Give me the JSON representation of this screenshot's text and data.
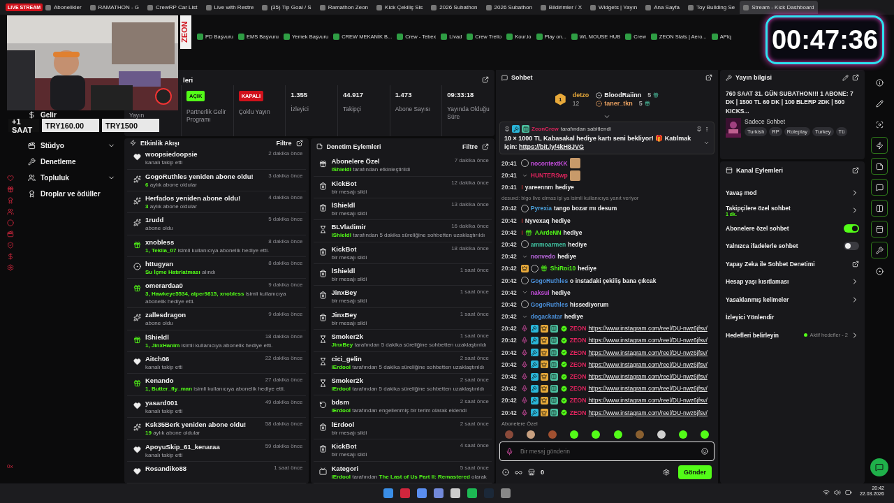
{
  "overlay": {
    "live": "LIVE STREAM",
    "brand": "ZEON",
    "donation": [
      "+1 SAAT",
      "TRY160.00",
      "TRY1500"
    ],
    "timer": "00:47:36"
  },
  "browser_tabs": [
    {
      "label": "Abonelikler",
      "selected": false
    },
    {
      "label": "RAMATHON - G",
      "selected": false
    },
    {
      "label": "CrewRP Car List",
      "selected": false
    },
    {
      "label": "Live with Restre",
      "selected": false
    },
    {
      "label": "(35) Tip Goal / S",
      "selected": false
    },
    {
      "label": "Ramathon Zeon",
      "selected": false
    },
    {
      "label": "Kick Çekiliş Sis",
      "selected": false
    },
    {
      "label": "2026 Subathon",
      "selected": false
    },
    {
      "label": "2026 Subathon",
      "selected": false
    },
    {
      "label": "Bildirimler / X",
      "selected": false
    },
    {
      "label": "Widgets | Yayın",
      "selected": false
    },
    {
      "label": "Ana Sayfa",
      "selected": false
    },
    {
      "label": "Toy Building Se",
      "selected": false
    },
    {
      "label": "Stream - Kick Dashboard",
      "selected": true
    }
  ],
  "bookmarks": [
    "PD Başvuru",
    "EMS Başvuru",
    "Yemek Başvuru",
    "CREW MEKANİK B...",
    "Crew - Tebex",
    "Livad",
    "Crew Trello",
    "Kour.io",
    "Play on...",
    "WL MOUSE HUB",
    "Crew",
    "ZEON Stats | Aero...",
    "APIq"
  ],
  "sidebar": {
    "items": [
      {
        "label": "Gelir",
        "kind": "plain"
      },
      {
        "label": "Stüdyo",
        "kind": "group"
      },
      {
        "label": "Denetleme",
        "kind": "plain"
      },
      {
        "label": "Topluluk",
        "kind": "group"
      },
      {
        "label": "Droplar ve ödüller",
        "kind": "plain"
      }
    ],
    "footer": "0x"
  },
  "stats": {
    "title": "leri",
    "cells": [
      {
        "kind": "label",
        "label": "Yayın"
      },
      {
        "kind": "badge",
        "badge": "AÇIK",
        "on": true,
        "label": "Partnerlik Gelir Programı"
      },
      {
        "kind": "badge",
        "badge": "KAPALI",
        "on": false,
        "label": "Çoklu Yayın"
      },
      {
        "kind": "value",
        "value": "1.355",
        "label": "İzleyici"
      },
      {
        "kind": "value",
        "value": "44.917",
        "label": "Takipçi"
      },
      {
        "kind": "value",
        "value": "1.473",
        "label": "Abone Sayısı"
      },
      {
        "kind": "value",
        "value": "09:33:18",
        "label": "Yayında Olduğu Süre"
      }
    ]
  },
  "activity": {
    "title": "Etkinlik Akışı",
    "filter": "Filtre",
    "items": [
      {
        "kind": "follow",
        "title": "woopsiedoopsie",
        "time": "2 dakika önce",
        "detail": "kanalı takip etti"
      },
      {
        "kind": "sub",
        "title": "GogoRuthles yeniden abone oldu!",
        "time": "3 dakika önce",
        "detail": "**6** aylık abone oldular"
      },
      {
        "kind": "sub",
        "title": "Herfados yeniden abone oldu!",
        "time": "4 dakika önce",
        "detail": "**3** aylık abone oldular"
      },
      {
        "kind": "sub",
        "title": "1rudd",
        "time": "5 dakika önce",
        "detail": "abone oldu"
      },
      {
        "kind": "gift",
        "title": "xnobless",
        "time": "8 dakika önce",
        "detail": "**1, Tekila_07** isimli kullanıcıya abonelik hediye etti."
      },
      {
        "kind": "reward",
        "title": "httugyan",
        "time": "8 dakika önce",
        "detail": "**Su İçme Hatırlatması** alındı"
      },
      {
        "kind": "gift",
        "title": "omerardaa0",
        "time": "9 dakika önce",
        "detail": "**3, Hawkeye5534, alper9815, xnobless** isimli kullanıcıya abonelik hediye etti."
      },
      {
        "kind": "sub",
        "title": "zallesdragon",
        "time": "9 dakika önce",
        "detail": "abone oldu"
      },
      {
        "kind": "gift",
        "title": "lShieldl",
        "time": "18 dakika önce",
        "detail": "**1, JinxHanim** isimli kullanıcıya abonelik hediye etti."
      },
      {
        "kind": "follow",
        "title": "Aitch06",
        "time": "22 dakika önce",
        "detail": "kanalı takip etti"
      },
      {
        "kind": "gift",
        "title": "Kenando",
        "time": "27 dakika önce",
        "detail": "**1, Butter_fly_man** isimli kullanıcıya abonelik hediye etti."
      },
      {
        "kind": "follow",
        "title": "yasard001",
        "time": "49 dakika önce",
        "detail": "kanalı takip etti"
      },
      {
        "kind": "sub",
        "title": "Ksk35Berk yeniden abone oldu!",
        "time": "58 dakika önce",
        "detail": "**19** aylık abone oldular"
      },
      {
        "kind": "follow",
        "title": "ApoyuSkip_61_kenaraa",
        "time": "59 dakika önce",
        "detail": "kanalı takip etti"
      },
      {
        "kind": "follow",
        "title": "Rosandiko88",
        "time": "1 saat önce"
      }
    ]
  },
  "moderation": {
    "title": "Denetim Eylemleri",
    "filter": "Filtre",
    "items": [
      {
        "kind": "mode",
        "title": "Abonelere Özel",
        "time": "7 dakika önce",
        "detail": "**lShieldl** tarafından etkinleştirildi"
      },
      {
        "kind": "delete",
        "title": "KickBot",
        "time": "12 dakika önce",
        "detail": "bir mesajı sildi"
      },
      {
        "kind": "delete",
        "title": "lShieldl",
        "time": "13 dakika önce",
        "detail": "bir mesajı sildi"
      },
      {
        "kind": "timeout",
        "title": "BLVladimir",
        "time": "16 dakika önce",
        "detail": "**lShieldl** tarafından 5 dakika süreliğine sohbetten uzaklaştırıldı"
      },
      {
        "kind": "delete",
        "title": "KickBot",
        "time": "18 dakika önce",
        "detail": "bir mesajı sildi"
      },
      {
        "kind": "delete",
        "title": "lShieldl",
        "time": "1 saat önce",
        "detail": "bir mesajı sildi"
      },
      {
        "kind": "delete",
        "title": "JinxBey",
        "time": "1 saat önce",
        "detail": "bir mesajı sildi"
      },
      {
        "kind": "delete",
        "title": "JinxBey",
        "time": "1 saat önce",
        "detail": "bir mesajı sildi"
      },
      {
        "kind": "timeout",
        "title": "Smoker2k",
        "time": "1 saat önce",
        "detail": "**JinxBey** tarafından 5 dakika süreliğine sohbetten uzaklaştırıldı"
      },
      {
        "kind": "timeout",
        "title": "cici_gelin",
        "time": "2 saat önce",
        "detail": "**lErdool** tarafından 5 dakika süreliğine sohbetten uzaklaştırıldı"
      },
      {
        "kind": "timeout",
        "title": "Smoker2k",
        "time": "2 saat önce",
        "detail": "**lErdool** tarafından 5 dakika süreliğine sohbetten uzaklaştırıldı"
      },
      {
        "kind": "banword",
        "title": "bdsm",
        "time": "2 saat önce",
        "detail": "**lErdool** tarafından engellenmiş bir terim olarak eklendi"
      },
      {
        "kind": "delete",
        "title": "lErdool",
        "time": "2 saat önce",
        "detail": "bir mesajı sildi"
      },
      {
        "kind": "delete",
        "title": "KickBot",
        "time": "4 saat önce",
        "detail": "bir mesajı sildi"
      },
      {
        "kind": "category",
        "title": "Kategori",
        "time": "5 saat önce",
        "detail": "**lErdool** tarafından **The Last of Us Part II: Remastered** olarak"
      }
    ]
  },
  "chat": {
    "title": "Sohbet",
    "leaders": [
      {
        "rank": "1",
        "name": "detzo",
        "count": "12"
      },
      {
        "name": "BloodRaiinn",
        "count": "5"
      },
      {
        "name": "taner_tkn",
        "count": "5"
      }
    ],
    "pinned": {
      "user": "ZeonCrew",
      "color": "#e0245e",
      "by": "tarafından sabitlendi",
      "text": "10 × 1000 TL Kabasakal hediye kartı seni bekliyor! 🎁 Katılmak için:",
      "link": "https://bit.ly/4kH8JVG"
    },
    "messages": [
      {
        "kind": "emote",
        "time": "20:41",
        "badges": [
          {
            "kind": "ring"
          }
        ],
        "user": "nocontextKK",
        "color": "#c04cd8"
      },
      {
        "kind": "emote",
        "time": "20:41",
        "badges": [
          {
            "kind": "va"
          }
        ],
        "user": "HUNTERSwp",
        "color": "#e0245e"
      },
      {
        "kind": "text",
        "time": "20:41",
        "badges": [
          {
            "kind": "dot"
          }
        ],
        "user": "yareennm",
        "color": "#e8e8e8",
        "text": "hediye"
      },
      {
        "kind": "reply",
        "text": "desuxd: bigo live elmas işi ya isimli kullanıcıya yanıt veriyor"
      },
      {
        "kind": "text",
        "time": "20:42",
        "badges": [
          {
            "kind": "ring"
          }
        ],
        "user": "Pyrexia",
        "color": "#4a9fd8",
        "text": "tango bozar mı desum"
      },
      {
        "kind": "text",
        "time": "20:42",
        "badges": [
          {
            "kind": "dot"
          }
        ],
        "user": "Nyvexaq",
        "color": "#e8e8e8",
        "text": "hediye"
      },
      {
        "kind": "text",
        "time": "20:42",
        "badges": [
          {
            "kind": "dot"
          },
          {
            "kind": "gift"
          }
        ],
        "user": "AArdeNN",
        "color": "#53fc18",
        "text": "hediye"
      },
      {
        "kind": "text",
        "time": "20:42",
        "badges": [
          {
            "kind": "ring"
          }
        ],
        "user": "ammoarmen",
        "color": "#3fbf9f",
        "text": "hediye"
      },
      {
        "kind": "text",
        "time": "20:42",
        "badges": [
          {
            "kind": "va"
          }
        ],
        "user": "nonvedo",
        "color": "#b565d8",
        "text": "hediye"
      },
      {
        "kind": "text",
        "time": "20:42",
        "badges": [
          {
            "kind": "crown"
          },
          {
            "kind": "ring"
          },
          {
            "kind": "gift"
          }
        ],
        "user": "ShiRoi10",
        "color": "#53fc18",
        "text": "hediye"
      },
      {
        "kind": "text",
        "time": "20:42",
        "badges": [
          {
            "kind": "ring"
          }
        ],
        "user": "GogoRuthles",
        "color": "#4a8fd8",
        "text": "o instadaki çekiliş bana çıkcak"
      },
      {
        "kind": "text",
        "time": "20:42",
        "badges": [
          {
            "kind": "va"
          }
        ],
        "user": "naksui",
        "color": "#c04cd8",
        "text": "hediye"
      },
      {
        "kind": "text",
        "time": "20:42",
        "badges": [
          {
            "kind": "ring"
          }
        ],
        "user": "GogoRuthles",
        "color": "#4a8fd8",
        "text": "hissediyorum"
      },
      {
        "kind": "text",
        "time": "20:42",
        "badges": [
          {
            "kind": "va"
          }
        ],
        "user": "dogackatar",
        "color": "#4a8fd8",
        "text": "hediye"
      },
      {
        "kind": "link",
        "time": "20:42",
        "badges": [
          {
            "kind": "mic"
          },
          {
            "kind": "mod"
          },
          {
            "kind": "crown"
          },
          {
            "kind": "sub"
          },
          {
            "kind": "verified"
          }
        ],
        "user": "ZEON",
        "color": "#e0245e",
        "text": "https://www.instagram.com/reel/DU-nwz6jfsv/"
      },
      {
        "kind": "link",
        "time": "20:42",
        "badges": [
          {
            "kind": "mic"
          },
          {
            "kind": "mod"
          },
          {
            "kind": "crown"
          },
          {
            "kind": "sub"
          },
          {
            "kind": "verified"
          }
        ],
        "user": "ZEON",
        "color": "#e0245e",
        "text": "https://www.instagram.com/reel/DU-nwz6jfsv/"
      },
      {
        "kind": "link",
        "time": "20:42",
        "badges": [
          {
            "kind": "mic"
          },
          {
            "kind": "mod"
          },
          {
            "kind": "crown"
          },
          {
            "kind": "sub"
          },
          {
            "kind": "verified"
          }
        ],
        "user": "ZEON",
        "color": "#e0245e",
        "text": "https://www.instagram.com/reel/DU-nwz6jfsv/"
      },
      {
        "kind": "link",
        "time": "20:42",
        "badges": [
          {
            "kind": "mic"
          },
          {
            "kind": "mod"
          },
          {
            "kind": "crown"
          },
          {
            "kind": "sub"
          },
          {
            "kind": "verified"
          }
        ],
        "user": "ZEON",
        "color": "#e0245e",
        "text": "https://www.instagram.com/reel/DU-nwz6jfsv/"
      },
      {
        "kind": "link",
        "time": "20:42",
        "badges": [
          {
            "kind": "mic"
          },
          {
            "kind": "mod"
          },
          {
            "kind": "crown"
          },
          {
            "kind": "sub"
          },
          {
            "kind": "verified"
          }
        ],
        "user": "ZEON",
        "color": "#e0245e",
        "text": "https://www.instagram.com/reel/DU-nwz6jfsv/"
      },
      {
        "kind": "link",
        "time": "20:42",
        "badges": [
          {
            "kind": "mic"
          },
          {
            "kind": "mod"
          },
          {
            "kind": "crown"
          },
          {
            "kind": "sub"
          },
          {
            "kind": "verified"
          }
        ],
        "user": "ZEON",
        "color": "#e0245e",
        "text": "https://www.instagram.com/reel/DU-nwz6jfsv/"
      },
      {
        "kind": "link",
        "time": "20:42",
        "badges": [
          {
            "kind": "mic"
          },
          {
            "kind": "mod"
          },
          {
            "kind": "crown"
          },
          {
            "kind": "sub"
          },
          {
            "kind": "verified"
          }
        ],
        "user": "ZEON",
        "color": "#e0245e",
        "text": "https://www.instagram.com/reel/DU-nwz6jfsv/"
      },
      {
        "kind": "link",
        "time": "20:42",
        "badges": [
          {
            "kind": "mic"
          },
          {
            "kind": "mod"
          },
          {
            "kind": "crown"
          },
          {
            "kind": "sub"
          },
          {
            "kind": "verified"
          }
        ],
        "user": "ZEON",
        "color": "#e0245e",
        "text": "https://www.instagram.com/reel/DU-nwz6jfsv/"
      }
    ],
    "emote_label": "Abonelere Özel",
    "emotes": [
      {
        "color": "#8a4a3a"
      },
      {
        "color": "#c8a080"
      },
      {
        "color": "#a05030"
      },
      {
        "color": "#53fc18"
      },
      {
        "color": "#53fc18"
      },
      {
        "color": "#53fc18"
      },
      {
        "color": "#8a6030"
      },
      {
        "color": "#d0d0d0"
      },
      {
        "color": "#53fc18"
      },
      {
        "color": "#53fc18"
      }
    ],
    "input": {
      "placeholder": "Bir mesaj gönderin"
    },
    "points": "0",
    "send": "Gönder"
  },
  "stream_info": {
    "title": "Yayın bilgisi",
    "stream_title": "760 SAAT 31. GÜN SUBATHON!!! 1 ABONE: 7 DK | 1500 TL 60 DK | 100 BLERP 2DK | 500 KICKS...",
    "category": "Sadece Sohbet",
    "tags": [
      "Turkish",
      "RP",
      "Roleplay",
      "Turkey",
      "Tü"
    ]
  },
  "channel_actions": {
    "title": "Kanal Eylemleri",
    "items": [
      {
        "kind": "chevron",
        "label": "Yavaş mod"
      },
      {
        "kind": "chevron",
        "label": "Takipçilere özel sohbet",
        "sub": "1 dk."
      },
      {
        "kind": "toggle",
        "label": "Abonelere özel sohbet",
        "on": true
      },
      {
        "kind": "toggle",
        "label": "Yalnızca ifadelerle sohbet",
        "on": false
      },
      {
        "kind": "external",
        "label": "Yapay Zeka ile Sohbet Denetimi"
      },
      {
        "kind": "chevron",
        "label": "Hesap yaşı kısıtlaması"
      },
      {
        "kind": "chevron",
        "label": "Yasaklanmış kelimeler"
      },
      {
        "kind": "plain",
        "label": "İzleyici Yönlendir"
      },
      {
        "kind": "goal",
        "label": "Hedefleri belirleyin",
        "sub": "Aktif hedefler - 2"
      }
    ]
  },
  "rail": [
    {
      "kind": "info",
      "active": false
    },
    {
      "kind": "pencil",
      "active": false
    },
    {
      "kind": "focus",
      "active": false
    },
    {
      "kind": "bolt",
      "active": true
    },
    {
      "kind": "note",
      "active": true
    },
    {
      "kind": "chat",
      "active": true
    },
    {
      "kind": "split",
      "active": true
    },
    {
      "kind": "panel",
      "active": true
    },
    {
      "kind": "wrench",
      "active": true
    },
    {
      "kind": "more",
      "active": false
    }
  ],
  "taskbar": {
    "time": "20:42",
    "date": "22.03.2026"
  }
}
